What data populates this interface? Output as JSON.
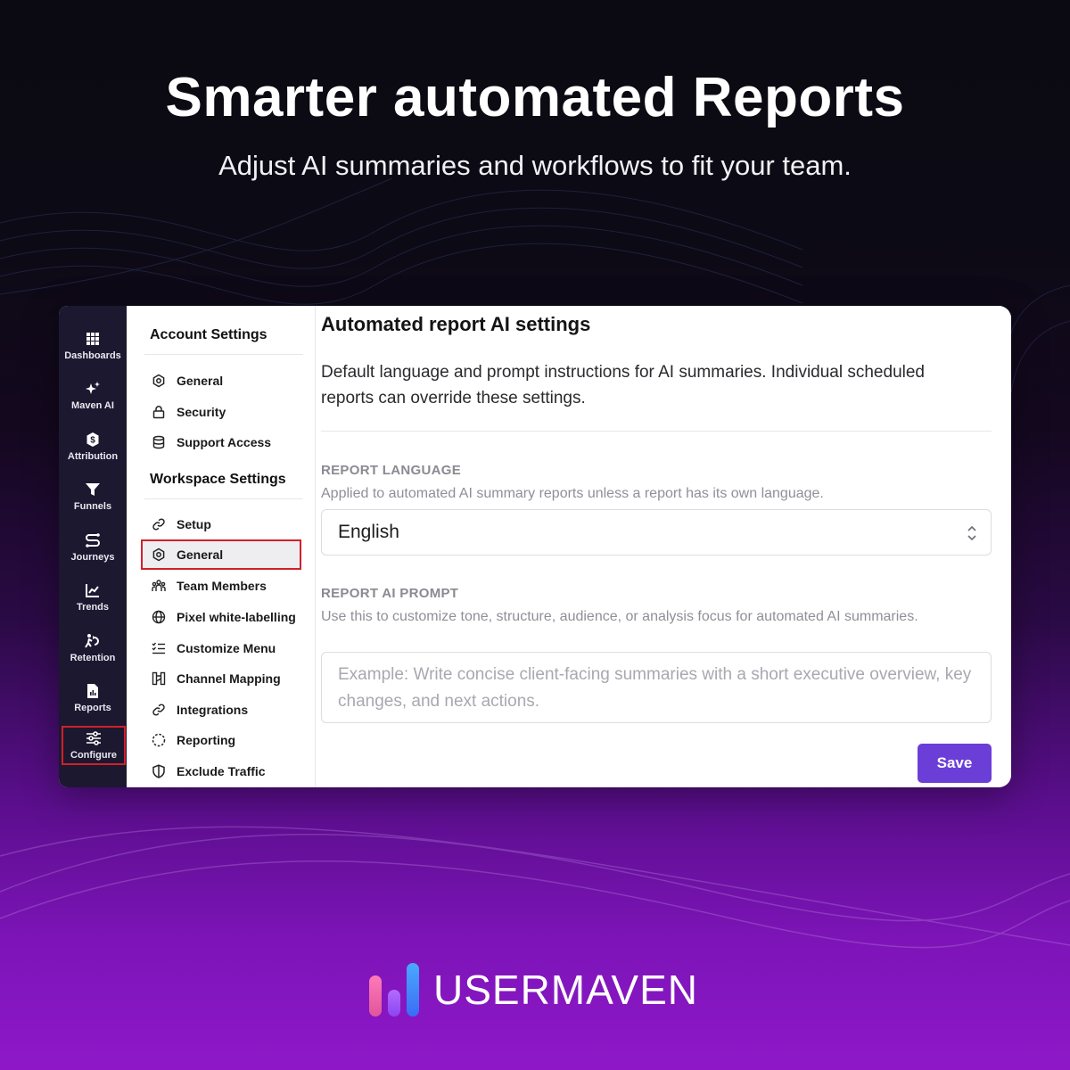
{
  "hero": {
    "title": "Smarter automated Reports",
    "subtitle": "Adjust AI summaries and workflows to fit your team."
  },
  "rail": {
    "items": [
      {
        "label": "Dashboards",
        "icon": "grid-icon"
      },
      {
        "label": "Maven AI",
        "icon": "sparkle-icon"
      },
      {
        "label": "Attribution",
        "icon": "dollar-circle-icon"
      },
      {
        "label": "Funnels",
        "icon": "funnel-icon"
      },
      {
        "label": "Journeys",
        "icon": "route-icon"
      },
      {
        "label": "Trends",
        "icon": "trend-chart-icon"
      },
      {
        "label": "Retention",
        "icon": "retention-icon"
      },
      {
        "label": "Reports",
        "icon": "report-file-icon"
      },
      {
        "label": "Configure",
        "icon": "sliders-icon",
        "active": true
      }
    ]
  },
  "settings_nav": {
    "account_heading": "Account Settings",
    "account_items": [
      {
        "label": "General",
        "icon": "gear-icon"
      },
      {
        "label": "Security",
        "icon": "lock-icon"
      },
      {
        "label": "Support Access",
        "icon": "database-icon"
      }
    ],
    "workspace_heading": "Workspace Settings",
    "workspace_items": [
      {
        "label": "Setup",
        "icon": "link-icon"
      },
      {
        "label": "General",
        "icon": "gear-icon",
        "selected": true
      },
      {
        "label": "Team Members",
        "icon": "team-icon"
      },
      {
        "label": "Pixel white-labelling",
        "icon": "globe-icon"
      },
      {
        "label": "Customize Menu",
        "icon": "list-check-icon"
      },
      {
        "label": "Channel Mapping",
        "icon": "channel-map-icon"
      },
      {
        "label": "Integrations",
        "icon": "link-icon"
      },
      {
        "label": "Reporting",
        "icon": "dashed-circle-icon"
      },
      {
        "label": "Exclude Traffic",
        "icon": "shield-icon"
      }
    ]
  },
  "main": {
    "title": "Automated report AI settings",
    "description": "Default language and prompt instructions for AI summaries. Individual scheduled reports can override these settings.",
    "language": {
      "label": "REPORT LANGUAGE",
      "help": "Applied to automated AI summary reports unless a report has its own language.",
      "value": "English"
    },
    "prompt": {
      "label": "REPORT AI PROMPT",
      "help": "Use this to customize tone, structure, audience, or analysis focus for automated AI summaries.",
      "placeholder": "Example: Write concise client-facing summaries with a short executive overview, key changes, and next actions."
    },
    "save_label": "Save"
  },
  "brand": {
    "name": "USERMAVEN"
  },
  "colors": {
    "accent": "#6c3ed8",
    "highlight": "#d2202a",
    "rail_bg": "#1b1830"
  }
}
